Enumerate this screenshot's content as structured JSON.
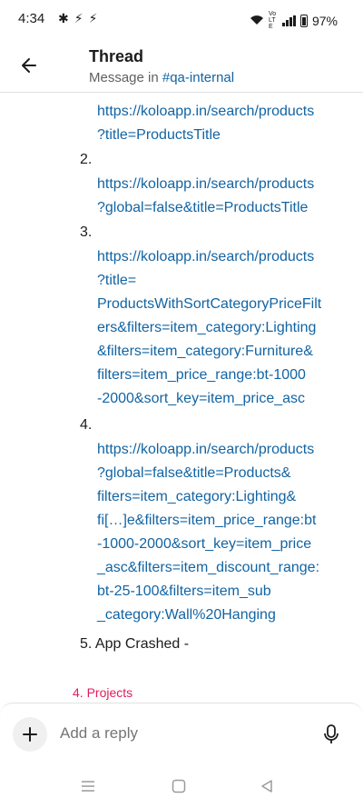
{
  "status_bar": {
    "time": "4:34",
    "left_icons": [
      "slack-icon",
      "missed-call-icon",
      "missed-call-icon"
    ],
    "battery": "97%",
    "network_label": "Vo LTE"
  },
  "header": {
    "title": "Thread",
    "subtitle_prefix": "Message in ",
    "channel": "#qa-internal"
  },
  "message": {
    "item1_url_lines": [
      "https://koloapp.in/search/products",
      "?title=ProductsTitle"
    ],
    "item2_number": "2.",
    "item2_url_lines": [
      "https://koloapp.in/search/products",
      "?global=false&title=ProductsTitle"
    ],
    "item3_number": "3.",
    "item3_url_lines": [
      "https://koloapp.in/search/products",
      "?title=",
      "ProductsWithSortCategoryPriceFilt",
      "ers&filters=item_category:Lighting",
      "&filters=item_category:Furniture&",
      "filters=item_price_range:bt-1000",
      "-2000&sort_key=item_price_asc"
    ],
    "item4_number": "4.",
    "item4_url_lines": [
      "https://koloapp.in/search/products",
      "?global=false&title=Products&",
      "filters=item_category:Lighting&",
      "fi[…]e&filters=item_price_range:bt",
      "-1000-2000&sort_key=item_price",
      "_asc&filters=item_discount_range:",
      "bt-25-100&filters=item_sub",
      "_category:Wall%20Hanging"
    ],
    "item5_text": "5. App Crashed -",
    "projects_label": "4. Projects"
  },
  "reply": {
    "placeholder": "Add a reply"
  },
  "colors": {
    "link": "#1264a3",
    "accent_pink": "#e01e5a"
  }
}
